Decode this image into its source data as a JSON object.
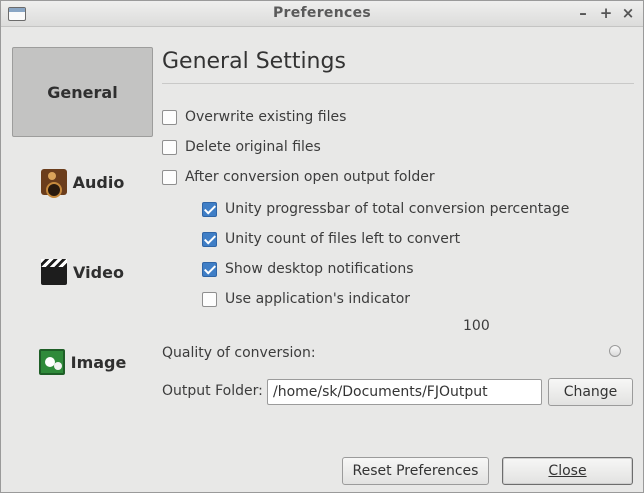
{
  "window": {
    "title": "Preferences",
    "controls": {
      "minimize": "–",
      "maximize": "+",
      "close": "×"
    }
  },
  "nav": {
    "items": [
      {
        "label": "General",
        "icon": "",
        "active": true
      },
      {
        "label": "Audio",
        "icon": "speaker-icon",
        "active": false
      },
      {
        "label": "Video",
        "icon": "clapperboard-icon",
        "active": false
      },
      {
        "label": "Image",
        "icon": "picture-icon",
        "active": false
      }
    ]
  },
  "general": {
    "heading": "General Settings",
    "options": [
      {
        "label": "Overwrite existing files",
        "checked": false
      },
      {
        "label": "Delete original files",
        "checked": false
      },
      {
        "label": "After conversion open output folder",
        "checked": false
      },
      {
        "label": "Unity progressbar of total conversion percentage",
        "checked": true
      },
      {
        "label": "Unity count of files left to convert",
        "checked": true
      },
      {
        "label": "Show desktop notifications",
        "checked": true
      },
      {
        "label": "Use application's indicator",
        "checked": false
      }
    ],
    "quality": {
      "label": "Quality of conversion:",
      "value": "100"
    },
    "output": {
      "label": "Output Folder:",
      "path": "/home/sk/Documents/FJOutput",
      "change_label": "Change"
    }
  },
  "footer": {
    "reset_label": "Reset Preferences",
    "close_label": "Close"
  },
  "colors": {
    "accent": "#3f7ec6",
    "background": "#e8e8e7"
  }
}
